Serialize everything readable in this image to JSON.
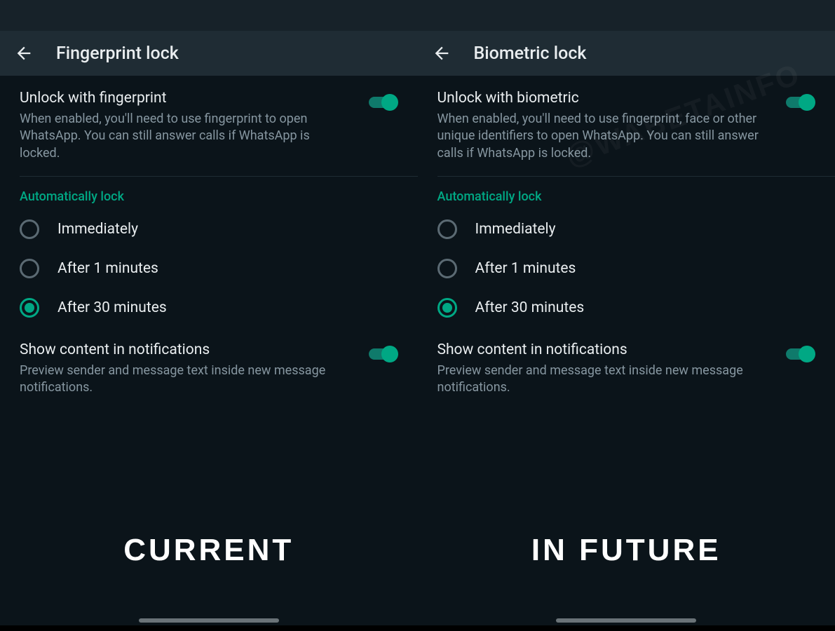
{
  "panels": [
    {
      "appBarTitle": "Fingerprint lock",
      "unlockTitle": "Unlock with fingerprint",
      "unlockDesc": "When enabled, you'll need to use fingerprint to open WhatsApp. You can still answer calls if WhatsApp is locked.",
      "autoLockHeader": "Automatically lock",
      "radioOptions": [
        "Immediately",
        "After 1 minutes",
        "After 30 minutes"
      ],
      "selectedIndex": 2,
      "notifTitle": "Show content in notifications",
      "notifDesc": "Preview sender and message text inside new message notifications.",
      "bottomLabel": "CURRENT"
    },
    {
      "appBarTitle": "Biometric lock",
      "unlockTitle": "Unlock with biometric",
      "unlockDesc": "When enabled, you'll need to use fingerprint, face or other unique identifiers to open WhatsApp. You can still answer calls if WhatsApp is locked.",
      "autoLockHeader": "Automatically lock",
      "radioOptions": [
        "Immediately",
        "After 1 minutes",
        "After 30 minutes"
      ],
      "selectedIndex": 2,
      "notifTitle": "Show content in notifications",
      "notifDesc": "Preview sender and message text inside new message notifications.",
      "bottomLabel": "IN FUTURE"
    }
  ],
  "watermark": "@WABETAINFO"
}
